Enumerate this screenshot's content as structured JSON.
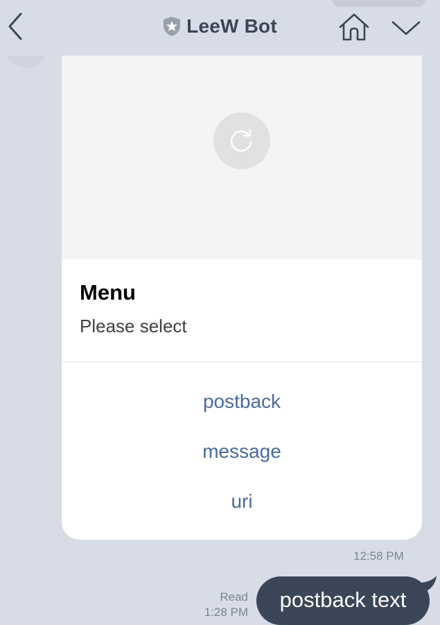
{
  "header": {
    "title": "LeeW Bot",
    "back_icon": "chevron-left-icon",
    "badge_icon": "shield-star-icon",
    "home_icon": "home-icon",
    "menu_icon": "chevron-down-icon"
  },
  "card": {
    "title": "Menu",
    "text": "Please select",
    "image_icon": "reload-icon",
    "actions": [
      {
        "label": "postback"
      },
      {
        "label": "message"
      },
      {
        "label": "uri"
      }
    ],
    "timestamp": "12:58 PM"
  },
  "outgoing": {
    "text": "postback text",
    "status": "Read",
    "timestamp": "1:28 PM"
  },
  "colors": {
    "background": "#d7dce6",
    "bubble": "#3b4658",
    "action_text": "#4a6a9c",
    "header_text": "#3b4556"
  }
}
